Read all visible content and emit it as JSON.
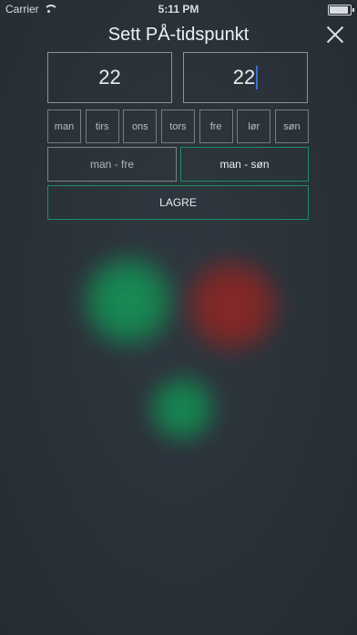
{
  "status_bar": {
    "carrier": "Carrier",
    "time": "5:11 PM"
  },
  "header": {
    "title": "Sett PÅ-tidspunkt"
  },
  "time": {
    "hours": "22",
    "minutes": "22"
  },
  "days": [
    {
      "label": "man"
    },
    {
      "label": "tirs"
    },
    {
      "label": "ons"
    },
    {
      "label": "tors"
    },
    {
      "label": "fre"
    },
    {
      "label": "lør"
    },
    {
      "label": "søn"
    }
  ],
  "presets": {
    "weekdays_label": "man - fre",
    "all_week_label": "man - søn"
  },
  "actions": {
    "save_label": "LAGRE"
  },
  "colors": {
    "accent_green": "#1f8e63",
    "blob_green": "#1b8f57",
    "blob_red": "#8a2a2a",
    "background": "#2a3139"
  },
  "icons": {
    "close": "close-icon",
    "wifi": "wifi-icon",
    "battery": "battery-icon"
  }
}
